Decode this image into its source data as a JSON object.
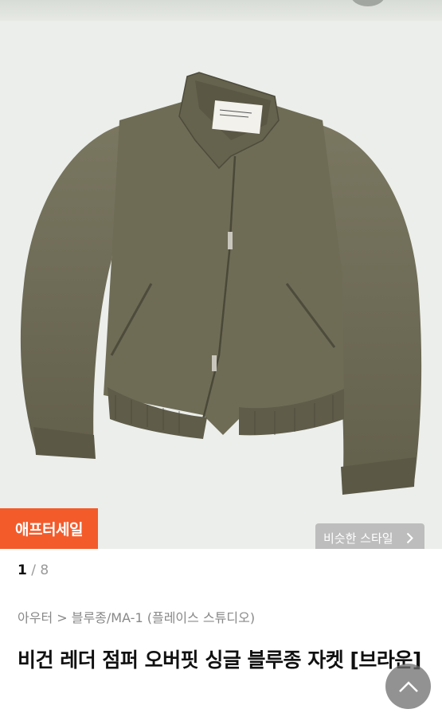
{
  "gallery": {
    "badge_label": "애프터세일",
    "similar_style_label": "비슷한 스타일",
    "pager_current": "1",
    "pager_separator": " / ",
    "pager_total": "8"
  },
  "breadcrumb": {
    "text": "아우터 > 블루종/MA-1 (플레이스 스튜디오)"
  },
  "product": {
    "title": "비건 레더 점퍼 오버핏 싱글 블루종 자켓 [브라운]"
  },
  "colors": {
    "badge": "#f35b2b",
    "jacket": "#6e6b55"
  },
  "icons": {
    "chevron": "chevron-right-icon",
    "scroll_top": "arrow-up-icon"
  }
}
